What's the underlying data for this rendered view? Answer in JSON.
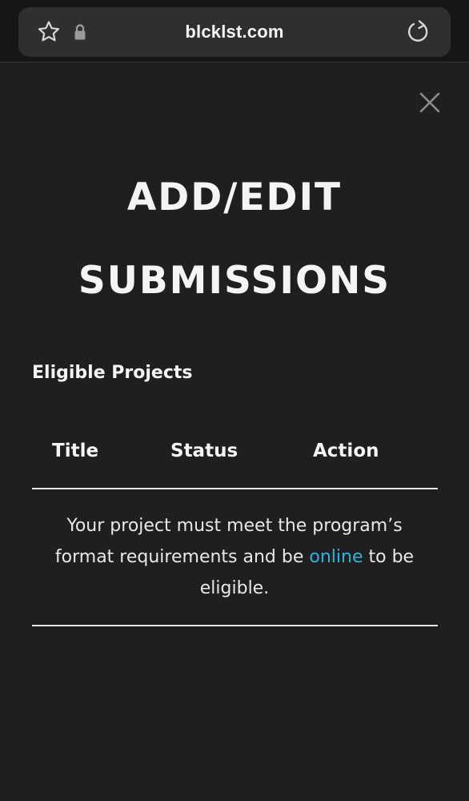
{
  "browser": {
    "url": "blcklst.com",
    "icons": {
      "bookmark": "star-icon",
      "secure": "lock-icon",
      "reload": "reload-icon"
    }
  },
  "modal": {
    "close_icon": "close-icon",
    "title_line1": "ADD/EDIT",
    "title_line2": "SUBMISSIONS",
    "section_heading": "Eligible Projects",
    "table": {
      "columns": [
        "Title",
        "Status",
        "Action"
      ]
    },
    "note": {
      "before_link": "Your project must meet the program’s format requirements and be ",
      "link_text": "online",
      "after_link": " to be eligible."
    }
  },
  "colors": {
    "background": "#1f1f1f",
    "url_bar": "#2f2f2f",
    "link": "#2bb4e6",
    "text": "#f4f4f4"
  }
}
